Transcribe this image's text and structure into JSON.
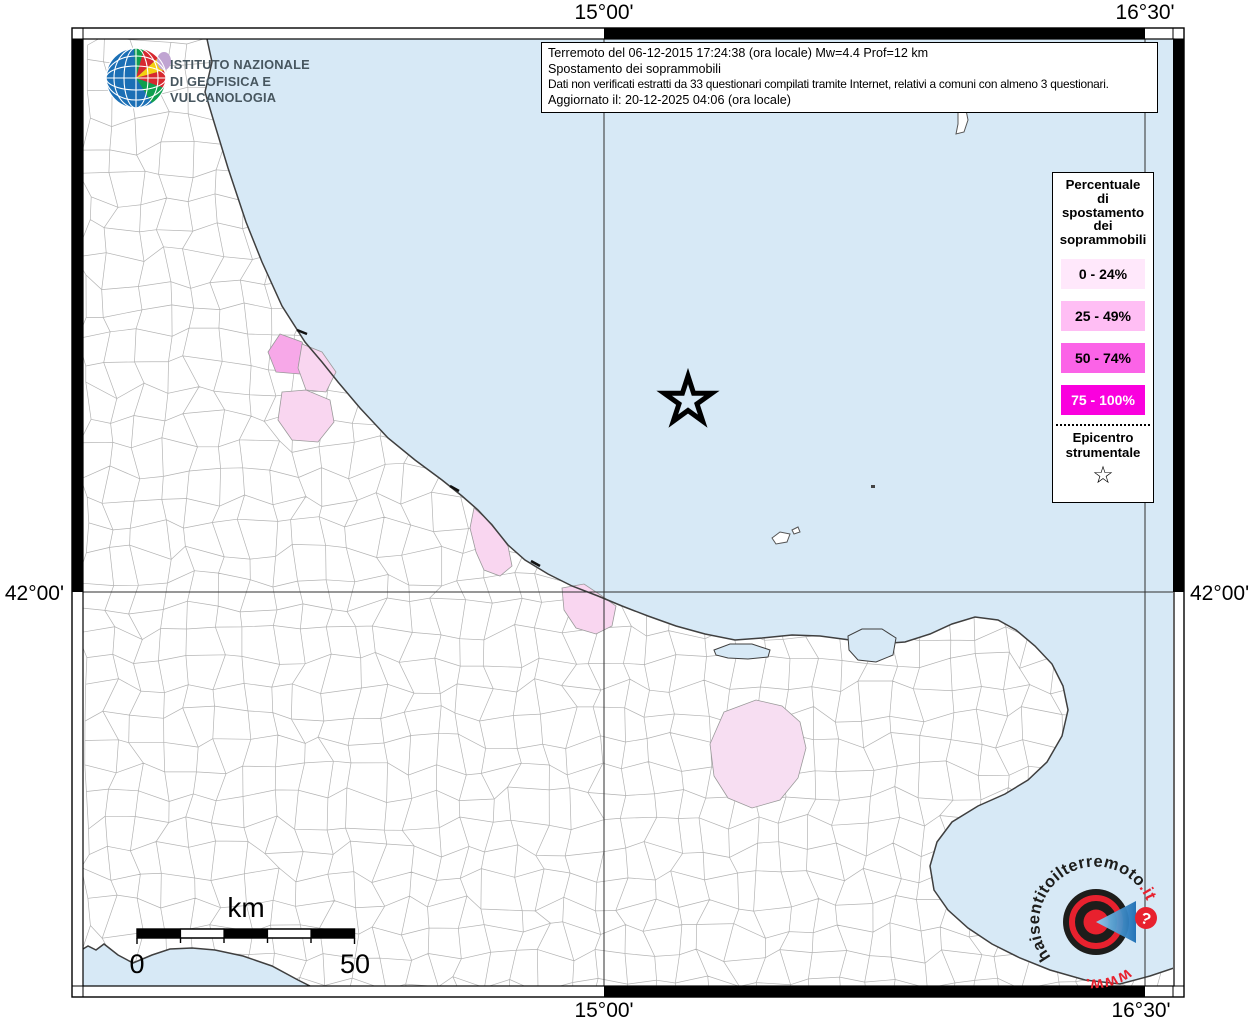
{
  "info_box": {
    "line1": "Terremoto del 06-12-2015 17:24:38 (ora locale) Mw=4.4 Prof=12 km",
    "line2": "Spostamento dei soprammobili",
    "line3": "Dati non verificati estratti da 33 questionari compilati tramite Internet, relativi a comuni con almeno 3 questionari.",
    "line4": "Aggiornato il: 20-12-2025 04:06 (ora locale)"
  },
  "ingv": {
    "name": "ISTITUTO NAZIONALE\nDI GEOFISICA E VULCANOLOGIA"
  },
  "axis": {
    "top_left": "15°00'",
    "top_right": "16°30'",
    "bottom_left": "15°00'",
    "bottom_right": "16°30'",
    "left": "42°00'",
    "right": "42°00'"
  },
  "legend": {
    "title": "Percentuale\ndi\nspostamento\ndei\nsoprammobili",
    "items": [
      {
        "label": "0 - 24%",
        "color": "#ffe8fb",
        "text_color": "#000000"
      },
      {
        "label": "25 - 49%",
        "color": "#ffbef4",
        "text_color": "#000000"
      },
      {
        "label": "50 - 74%",
        "color": "#fb63e7",
        "text_color": "#000000"
      },
      {
        "label": "75 - 100%",
        "color": "#fa00de",
        "text_color": "#ffffff"
      }
    ],
    "epicenter_title": "Epicentro\nstrumentale",
    "epicenter_symbol": "☆"
  },
  "scale_bar": {
    "unit_label": "km",
    "start_label": "0",
    "end_label": "50"
  },
  "watermark": {
    "url_main": "haisentitoilterremoto",
    "url_suffix": ".it",
    "url_prefix": "www.",
    "badge": "?",
    "red": "#e31e26",
    "blue": "#2a8fd0"
  },
  "map": {
    "sea_color": "#d7e9f6",
    "land_color": "#ffffff",
    "boundary_color": "#b4b4b4",
    "shading": {
      "light": "#f7a8e8",
      "pale": "#f9d6f0",
      "palest": "#f7def2"
    }
  }
}
